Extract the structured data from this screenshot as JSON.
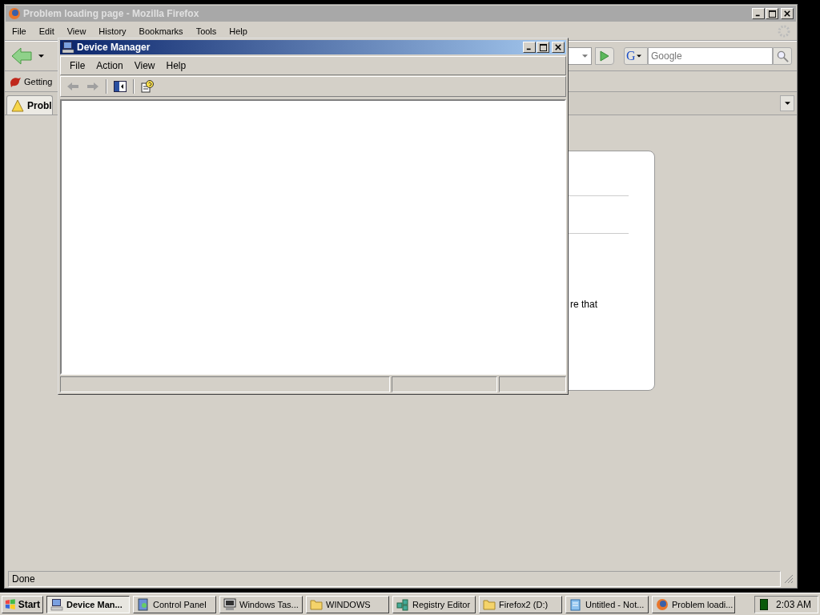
{
  "firefox": {
    "title": "Problem loading page - Mozilla Firefox",
    "menu": [
      "File",
      "Edit",
      "View",
      "History",
      "Bookmarks",
      "Tools",
      "Help"
    ],
    "search": {
      "engine_logo": "G",
      "placeholder": "Google"
    },
    "bookmarks": [
      "Getting"
    ],
    "tabs": [
      {
        "label": "Probl",
        "selected": true
      }
    ],
    "page_text": "re that",
    "status": "Done"
  },
  "device_manager": {
    "title": "Device Manager",
    "menu": [
      "File",
      "Action",
      "View",
      "Help"
    ]
  },
  "taskbar": {
    "start": "Start",
    "buttons": [
      {
        "label": "Device Man...",
        "kind": "computer",
        "selected": true
      },
      {
        "label": "Control Panel",
        "kind": "panel",
        "selected": false
      },
      {
        "label": "Windows Tas...",
        "kind": "monitor",
        "selected": false
      },
      {
        "label": "WINDOWS",
        "kind": "folder",
        "selected": false
      },
      {
        "label": "Registry Editor",
        "kind": "registry",
        "selected": false
      },
      {
        "label": "Firefox2 (D:)",
        "kind": "folder",
        "selected": false
      },
      {
        "label": "Untitled - Not...",
        "kind": "notepad",
        "selected": false
      },
      {
        "label": "Problem loadi...",
        "kind": "browser",
        "selected": false
      }
    ],
    "clock": "2:03 AM"
  }
}
